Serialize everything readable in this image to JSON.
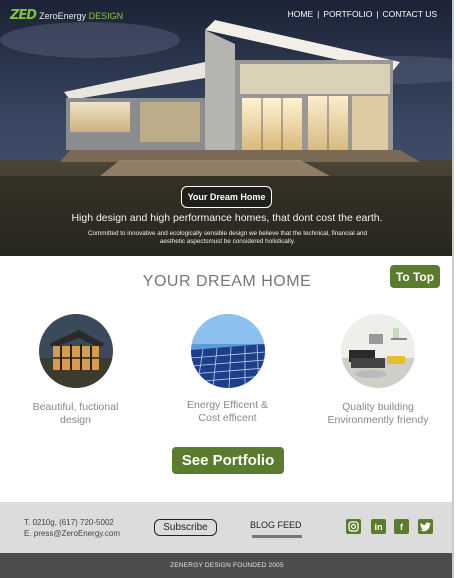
{
  "header": {
    "logo_mark": "ZED",
    "logo_text": "ZeroEnergy",
    "logo_accent": "DESIGN",
    "nav": [
      "HOME",
      "PORTFOLIO",
      "CONTACT US"
    ],
    "nav_separator": "|"
  },
  "hero": {
    "badge": "Your Dream Home",
    "tagline": "High design and high performance homes, that dont cost the earth.",
    "subtext": "Committed to innovative and ecologically sensible design we believe that the technical, financial and aesthetic aspectsmust be considered holistically."
  },
  "main": {
    "title": "YOUR DREAM HOME",
    "to_top": "To Top",
    "features": [
      {
        "label": "Beautiful, fuctional design"
      },
      {
        "label": "Energy Efficent & Cost efficent"
      },
      {
        "label": "Quality  building Environmently friendy"
      }
    ],
    "portfolio_button": "See Portfolio"
  },
  "footer": {
    "phone": "T. 0210g, (617) 720-5002",
    "email": "E. press@ZeroEnergy.com",
    "subscribe": "Subscribe",
    "blog_feed": "BLOG FEED",
    "social": [
      {
        "icon": "instagram-icon",
        "glyph": "◘"
      },
      {
        "icon": "linkedin-icon",
        "glyph": "in"
      },
      {
        "icon": "facebook-icon",
        "glyph": "f"
      },
      {
        "icon": "twitter-icon",
        "glyph": "t"
      }
    ],
    "copyright": "ZENERGY DESIGN FOUNDED 2005"
  },
  "colors": {
    "accent_green": "#5b7b2e",
    "logo_green": "#7ec23a",
    "footer_gray": "#dcdcdc",
    "bottom_bar": "#4d4d4d"
  }
}
